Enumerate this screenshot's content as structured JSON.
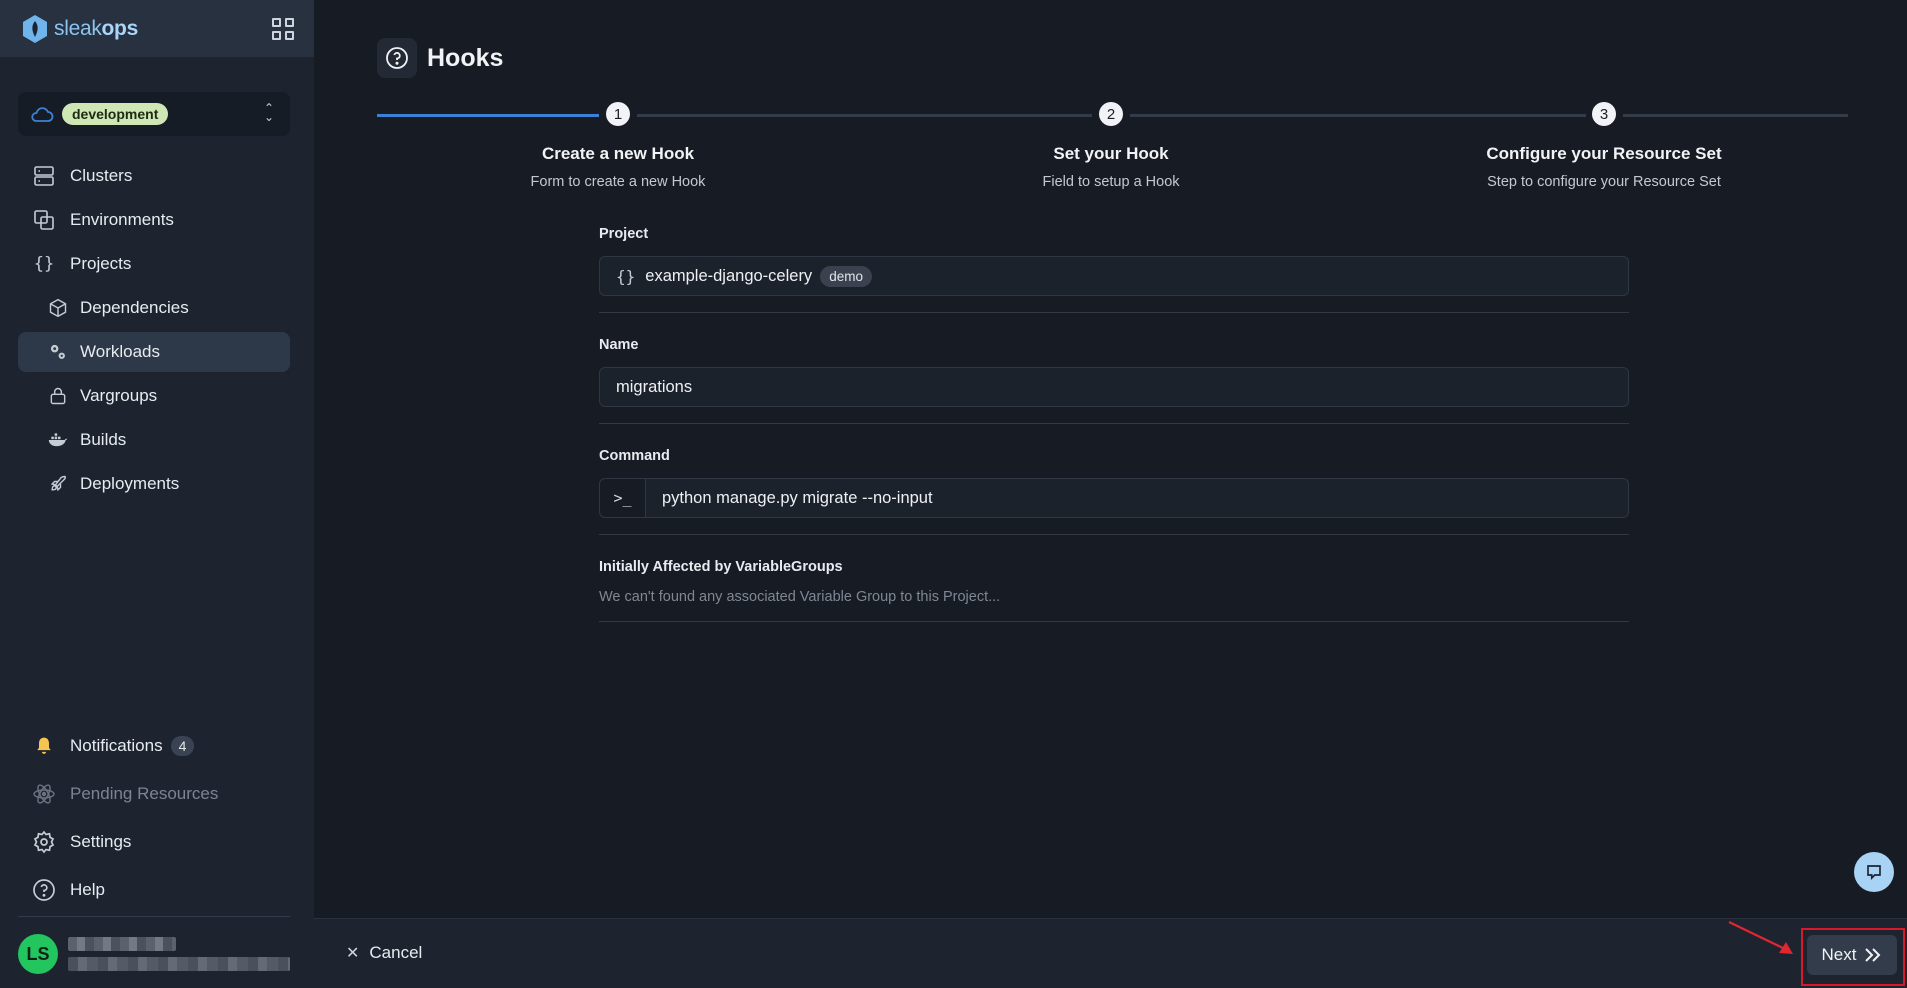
{
  "brand": {
    "name_light": "sleak",
    "name_bold": "ops"
  },
  "environment": {
    "selected": "development"
  },
  "nav": {
    "clusters": "Clusters",
    "environments": "Environments",
    "projects": "Projects",
    "dependencies": "Dependencies",
    "workloads": "Workloads",
    "vargroups": "Vargroups",
    "builds": "Builds",
    "deployments": "Deployments"
  },
  "bottom_nav": {
    "notifications": "Notifications",
    "notifications_count": "4",
    "pending_resources": "Pending Resources",
    "settings": "Settings",
    "help": "Help"
  },
  "user": {
    "initials": "LS"
  },
  "page": {
    "title": "Hooks"
  },
  "steps": [
    {
      "number": "1",
      "title": "Create a new Hook",
      "subtitle": "Form to create a new Hook"
    },
    {
      "number": "2",
      "title": "Set your Hook",
      "subtitle": "Field to setup a Hook"
    },
    {
      "number": "3",
      "title": "Configure your Resource Set",
      "subtitle": "Step to configure your Resource Set"
    }
  ],
  "form": {
    "project_label": "Project",
    "project_value": "example-django-celery",
    "project_badge": "demo",
    "name_label": "Name",
    "name_value": "migrations",
    "command_label": "Command",
    "command_prefix": ">_",
    "command_value": "python manage.py migrate --no-input",
    "vargroups_label": "Initially Affected by VariableGroups",
    "vargroups_empty": "We can't found any associated Variable Group to this Project..."
  },
  "footer": {
    "cancel": "Cancel",
    "next": "Next"
  },
  "colors": {
    "accent": "#3b82d6",
    "env_badge": "#cfe6b5",
    "avatar": "#22c55e",
    "highlight": "#d7192b"
  }
}
